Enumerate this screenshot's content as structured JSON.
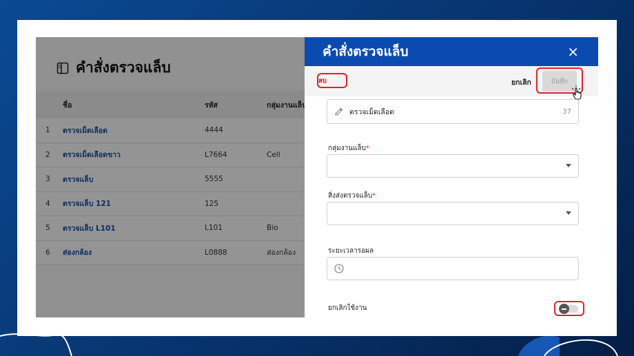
{
  "page": {
    "title": "คำสั่งตรวจแล็บ",
    "table": {
      "headers": [
        "ชื่อ",
        "รหัส",
        "กลุ่มงานแล็บ"
      ],
      "rows": [
        {
          "idx": "1",
          "name": "ตรวจเม็ดเลือด",
          "code": "4444",
          "group": ""
        },
        {
          "idx": "2",
          "name": "ตรวจเม็ดเลือดขาว",
          "code": "L7664",
          "group": "Cell"
        },
        {
          "idx": "3",
          "name": "ตรวจแล็บ",
          "code": "5555",
          "group": ""
        },
        {
          "idx": "4",
          "name": "ตรวจแล็บ 121",
          "code": "125",
          "group": ""
        },
        {
          "idx": "5",
          "name": "ตรวจแล็บ L101",
          "code": "L101",
          "group": "Bio"
        },
        {
          "idx": "6",
          "name": "ส่องกล้อง",
          "code": "L0888",
          "group": "ส่องกล้อง"
        }
      ]
    }
  },
  "drawer": {
    "title": "คำสั่งตรวจแล็บ",
    "close_label": "×",
    "toolbar": {
      "delete_label": "ลบ",
      "cancel_label": "ยกเลิก",
      "save_label": "บันทึก"
    },
    "name_field": {
      "value": "ตรวจเม็ดเลือด",
      "counter": "37"
    },
    "lab_group": {
      "label": "กลุ่มงานแล็บ",
      "required_mark": "*",
      "value": ""
    },
    "send_to": {
      "label": "สิ่งส่งตรวจแล็บ",
      "required_mark": "*",
      "value": ""
    },
    "wait_time": {
      "label": "ระยะเวลารอผล",
      "value": ""
    },
    "inactive": {
      "label": "ยกเลิกใช้งาน"
    }
  },
  "colors": {
    "drawer_header": "#0b4bb0",
    "highlight": "#e0202a",
    "link": "#1a4fa3"
  },
  "icons": {
    "page": "panel-icon",
    "name_field": "pencil-icon",
    "time_field": "clock-icon",
    "cursor": "hand-pointer-icon"
  }
}
